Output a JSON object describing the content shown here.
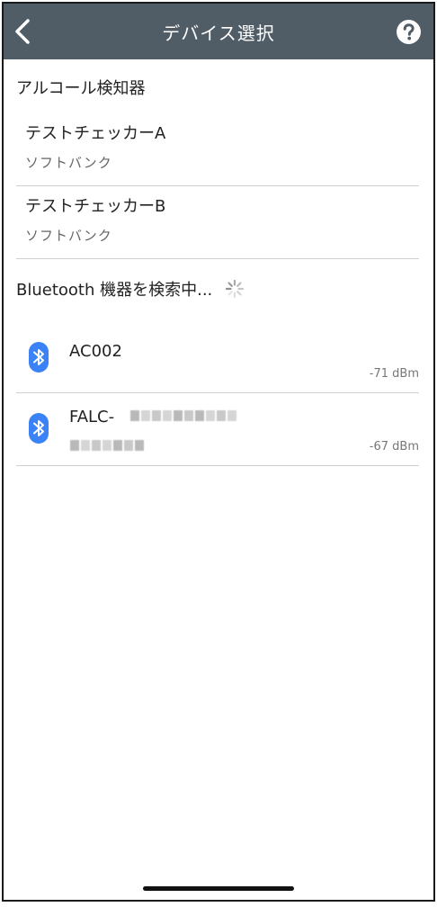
{
  "navbar": {
    "title": "デバイス選択",
    "back_icon": "chevron-left-icon",
    "help_icon": "question-circle-icon",
    "background_color": "#505c66"
  },
  "registered_section": {
    "header": "アルコール検知器",
    "devices": [
      {
        "name": "テストチェッカーA",
        "subtitle": "ソフトバンク"
      },
      {
        "name": "テストチェッカーB",
        "subtitle": "ソフトバンク"
      }
    ]
  },
  "bluetooth_section": {
    "header": "Bluetooth 機器を検索中...",
    "spinner_icon": "loading-spinner-icon",
    "bluetooth_color": "#3b82f6",
    "devices": [
      {
        "name": "AC002",
        "rssi": "-71 dBm",
        "icon": "bluetooth-icon"
      },
      {
        "name": "FALC-",
        "rssi": "-67 dBm",
        "icon": "bluetooth-icon"
      }
    ]
  }
}
